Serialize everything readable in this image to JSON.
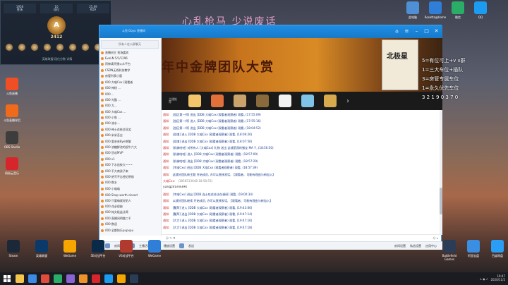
{
  "overlay_title": "心乱枪马 少说废话",
  "rank_panel": {
    "stats": [
      {
        "value": "1958",
        "label": "胜场"
      },
      {
        "value": "10",
        "label": "段位"
      },
      {
        "value": "25.69",
        "label": "KDA"
      }
    ],
    "emblem_letter": "A",
    "score": "2412",
    "footer": "英雄联盟 段位分数 详情"
  },
  "desktop_icons_left": [
    {
      "name": "斗鱼直播",
      "color": "#f04e24"
    },
    {
      "name": "斗鱼直播伴侣",
      "color": "#ef6b1b"
    },
    {
      "name": "OBS Studio",
      "color": "#3d3d3d"
    },
    {
      "name": "网易云音乐",
      "color": "#d6262b"
    }
  ],
  "desktop_icons_top_right": [
    {
      "name": "此电脑",
      "color": "#4e8fd6"
    },
    {
      "name": "Rosetta@home",
      "color": "#2f7fd8"
    },
    {
      "name": "微信",
      "color": "#2aae67"
    },
    {
      "name": "QQ",
      "color": "#1b9cf0"
    }
  ],
  "app_window": {
    "title": "斗鱼 Doyu 直播间",
    "left_list": {
      "header": "所有人在公屏聊天",
      "items": [
        "直播间主 到场嘉宾",
        "EvoLN 5/1/1296",
        "阿神请开播公众平台",
        "CSDN无线科技教学",
        "房管列表小窗",
        "000 大喵Cxx (观看者",
        "000 神秘 ...",
        "000 ...",
        "000 光酷 ...",
        "000 大...",
        "000 大喵Cxx ...",
        "000 小鱼 ...",
        "000 流水...",
        "000 神士花枝总狂笑",
        "000 米米吾吉",
        "000 愛芸芸Bye饼酸",
        "000 浓糖鲜浓的很牛六大",
        "000 狂欢MVP",
        "000 v1",
        "000 下水追枝大~~~",
        "000 不大南孩子来",
        "000 绝写不忘经纪明前",
        "000 数水",
        "000 小喵喵",
        "000 Shop worth closed",
        "000 只要嗨就好奶人",
        "000 花必很缺",
        "000 纯文极盐法哥",
        "000 直播间明路二千",
        "000 数迎",
        "000 全都快乐pupupu"
      ]
    },
    "banner_text": "年中金牌团队大赏",
    "book_title": "北极星",
    "strip_label": "主播推荐",
    "strip_icons": [
      {
        "name": "game-1",
        "color": "#f3c46a"
      },
      {
        "name": "game-2",
        "color": "#e2703a"
      },
      {
        "name": "game-3",
        "color": "#c9a36b"
      },
      {
        "name": "game-4",
        "color": "#8a6a3a"
      },
      {
        "name": "game-5",
        "color": "#f2f2f2"
      },
      {
        "name": "game-6",
        "color": "#7fc4e8"
      },
      {
        "name": "game-7",
        "color": "#d9a94d"
      }
    ],
    "chat_lines": [
      {
        "tag": "通知:",
        "text": "[战区第一师] 进出 [DDB 大喵Cxx (观看者观察者) 观看, (17:55:09)",
        "kind": "normal"
      },
      {
        "tag": "通知:",
        "text": "[战区第一师] 进入 [DDB 大喵Cxx (观看者观察者) 观看, (17:55:16)",
        "kind": "normal"
      },
      {
        "tag": "通知:",
        "text": "[战区第一师] 进出 [DDB 大喵Cxx (观看者观察者) 观看, (18:04:52)",
        "kind": "normal"
      },
      {
        "tag": "通知:",
        "text": "[战魂] 进入 [DDB 大喵Cxx (观看者观察者) 观看, (18:06:26)",
        "kind": "normal"
      },
      {
        "tag": "通知:",
        "text": "[战魂] 进出 [DDB 大喵Cxx (观看者观察者) 观看, (18:07:56)",
        "kind": "normal"
      },
      {
        "tag": "通知:",
        "text": "[机械哈哈] 对所有人 [大喵Cxx] 礼物 送出 这就是我的猪宝 MA !!, (18:56:50)",
        "kind": "normal"
      },
      {
        "tag": "通知:",
        "text": "[机械哈哈] 进入 [DDB 大喵Cxx (观看者观察者) 观看, (18:57:09)",
        "kind": "normal"
      },
      {
        "tag": "通知:",
        "text": "[机械哈哈] 进出 [DDB 大喵Cxx (观看者观察者) 观看, (18:57:29)",
        "kind": "normal"
      },
      {
        "tag": "通知:",
        "text": "[木喵Cxx] 进出 [DDB 大喵Cxx (观看者观察者) 观看, (18:57:39)",
        "kind": "normal"
      },
      {
        "tag": "通知:",
        "text": "这就好团队新主题 开始成员, 亦可以直接发话, 【观看者、可能有理由与新加入】",
        "kind": "normal"
      },
      {
        "tag": "大喵Cxx:",
        "text": "(1856513648 18:58:53)",
        "kind": "sys"
      },
      {
        "tag": "",
        "text": "yangzifan9394",
        "kind": "user"
      },
      {
        "tag": "通知:",
        "text": "[木喵Cxx] 进出 [DDB 连士吃花技法在调研] 观看, (19:00:34)",
        "kind": "normal"
      },
      {
        "tag": "通知:",
        "text": "以就好团队继续 开始成员, 亦可以直接发话, 【观看者、可能有理由与新加入】",
        "kind": "normal"
      },
      {
        "tag": "通知:",
        "text": "[鳌拜] 进入 [DDB 大喵Cxx (观看者观察者) 观看, (19:43:06)",
        "kind": "normal"
      },
      {
        "tag": "通知:",
        "text": "[鳌拜] 进出 [DDB 大喵Cxx (观看者观察者) 观看, (19:47:14)",
        "kind": "normal"
      },
      {
        "tag": "通知:",
        "text": "[大力] 进入 [DDB 大喵Cxx (观看者观察者) 观看, (19:47:16)",
        "kind": "normal"
      },
      {
        "tag": "通知:",
        "text": "[大力] 进出 [DDB 大喵Cxx (观看者观察者) 观看, (19:47:18)",
        "kind": "normal"
      }
    ],
    "bottom_bar": {
      "items": [
        "房间管理",
        "主播活动",
        "播放设置",
        "发送"
      ],
      "right_items": [
        "房间设置",
        "私信设置",
        "应用中心"
      ]
    }
  },
  "right_overlay_lines": [
    "5=有位可上+v x群",
    "1=三大车位+插队",
    "3=房管专属车位",
    "1=永久优先车位",
    "3 2 1 9 0 3 7 0"
  ],
  "desktop_icons_bottom": [
    {
      "name": "Steam",
      "color": "#1b2838"
    },
    {
      "name": "英雄联盟",
      "color": "#0b3a6a"
    },
    {
      "name": "WeGame",
      "color": "#f7a600"
    },
    {
      "name": "5E对战平台",
      "color": "#0a2a4a"
    },
    {
      "name": "VS对战平台",
      "color": "#b03a2e"
    },
    {
      "name": "WeGame",
      "color": "#2f7fd8"
    }
  ],
  "desktop_icons_bottom_right": [
    {
      "name": "Battlefield Games",
      "color": "#2b3c57"
    },
    {
      "name": "阿里云盘",
      "color": "#3a8fe2"
    },
    {
      "name": "百度网盘",
      "color": "#2a9df4"
    }
  ],
  "taskbar": {
    "apps": [
      "#f5c54b",
      "#3c8ae5",
      "#e14b3b",
      "#2aae67",
      "#8a63d2",
      "#f0922b",
      "#d6262b",
      "#1b9cf0",
      "#f7a600",
      "#2b3c57"
    ],
    "time": "19:47",
    "date": "2020/11/2"
  }
}
